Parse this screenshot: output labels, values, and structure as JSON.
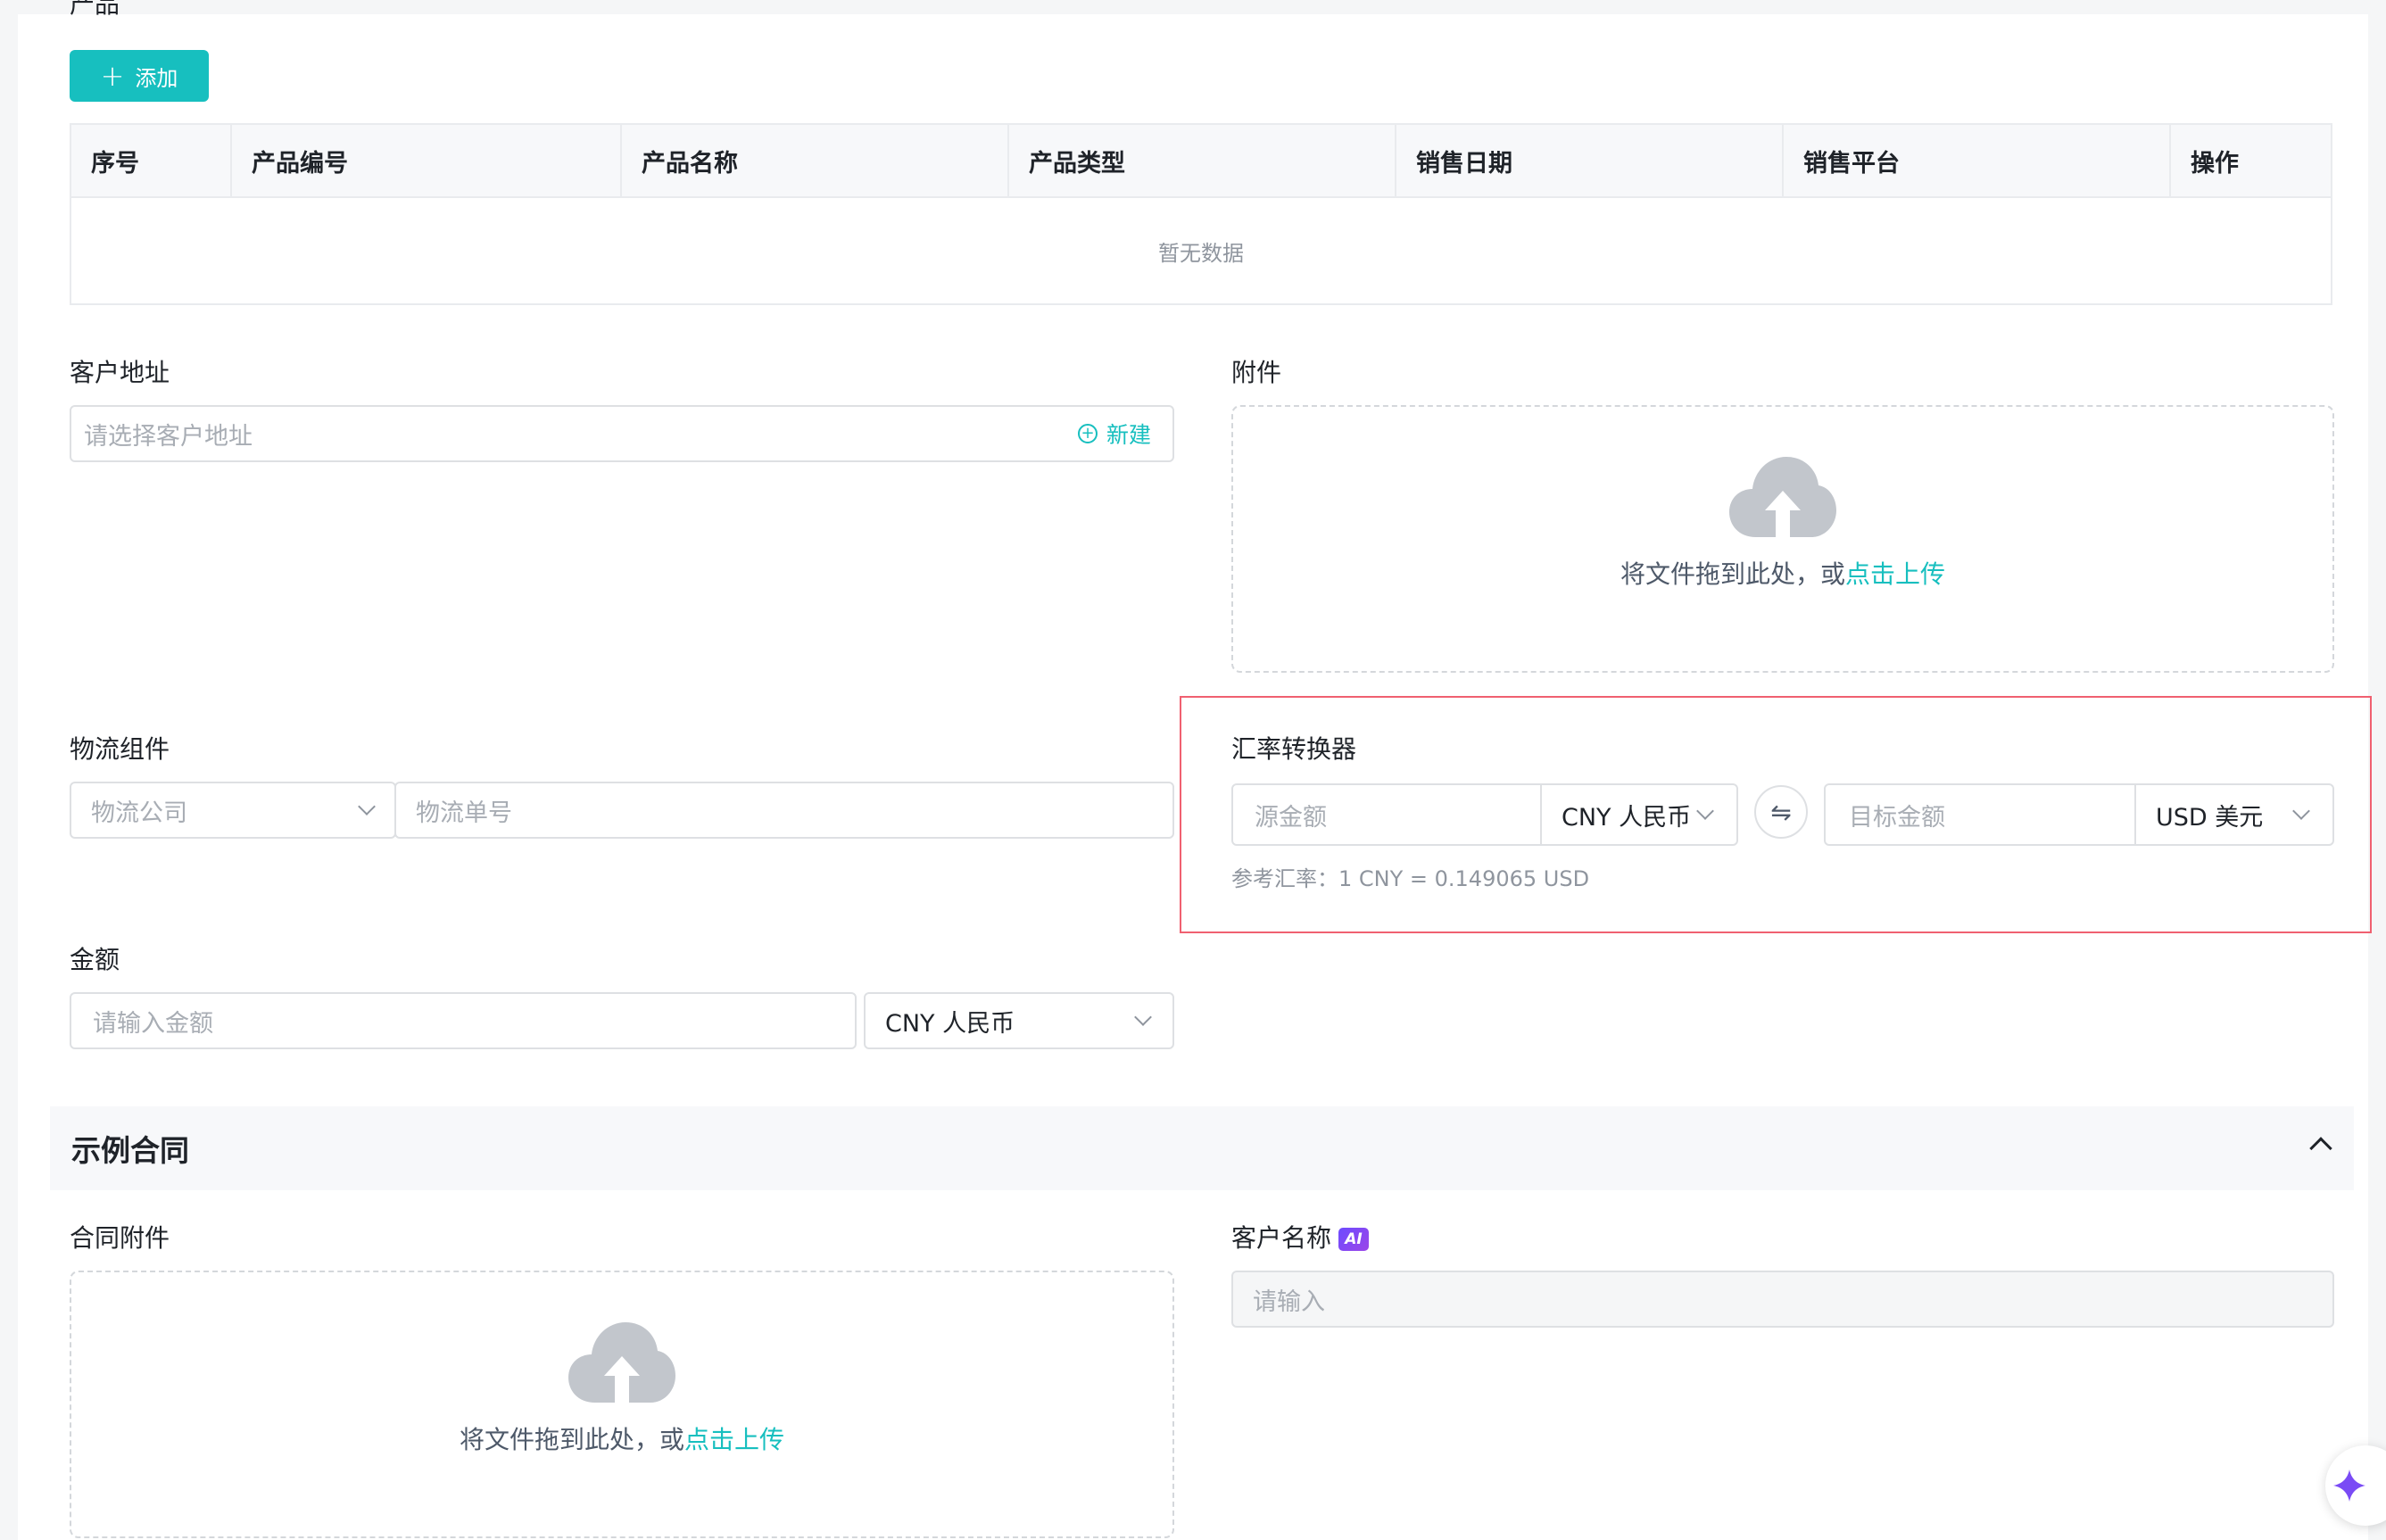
{
  "product_section": {
    "label": "产品",
    "add_button": "添加"
  },
  "product_table": {
    "columns": [
      "序号",
      "产品编号",
      "产品名称",
      "产品类型",
      "销售日期",
      "销售平台",
      "操作"
    ],
    "empty_text": "暂无数据"
  },
  "customer_address": {
    "label": "客户地址",
    "placeholder": "请选择客户地址",
    "new_link": "新建"
  },
  "attachment": {
    "label": "附件",
    "drop_text": "将文件拖到此处，或",
    "upload_link": "点击上传"
  },
  "logistics": {
    "label": "物流组件",
    "company_placeholder": "物流公司",
    "number_placeholder": "物流单号"
  },
  "converter": {
    "label": "汇率转换器",
    "source_placeholder": "源金额",
    "source_currency": "CNY 人民币",
    "swap_icon": "⇋",
    "target_placeholder": "目标金额",
    "target_currency": "USD 美元",
    "rate_text": "参考汇率：1 CNY = 0.149065 USD"
  },
  "amount": {
    "label": "金额",
    "placeholder": "请输入金额",
    "currency": "CNY 人民币"
  },
  "contract_section": {
    "title": "示例合同"
  },
  "contract_attachment": {
    "label": "合同附件",
    "drop_text": "将文件拖到此处，或",
    "upload_link": "点击上传"
  },
  "customer_name": {
    "label": "客户名称",
    "ai_badge": "AI",
    "placeholder": "请输入"
  },
  "colors": {
    "accent": "#17bfbf",
    "highlight_border": "#f06070",
    "ai_badge": "#7a4bf5"
  }
}
